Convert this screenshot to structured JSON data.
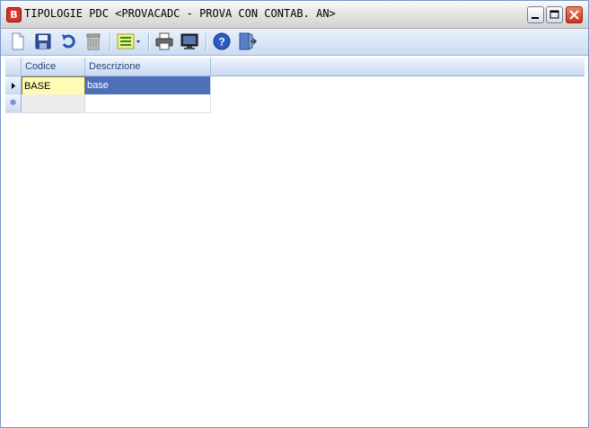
{
  "window": {
    "title": "TIPOLOGIE PDC <PROVACADC - PROVA CON CONTAB. AN>",
    "app_icon_letter": "B"
  },
  "toolbar": {
    "buttons": [
      {
        "name": "new-document-icon"
      },
      {
        "name": "save-icon"
      },
      {
        "name": "undo-icon"
      },
      {
        "name": "delete-trash-icon"
      },
      {
        "name": "list-options-icon"
      },
      {
        "name": "print-icon"
      },
      {
        "name": "preview-monitor-icon"
      },
      {
        "name": "help-icon"
      },
      {
        "name": "exit-icon"
      }
    ]
  },
  "grid": {
    "columns": [
      "Codice",
      "Descrizione"
    ],
    "rows": [
      {
        "codice": "BASE",
        "descrizione": "base",
        "selected": true
      }
    ],
    "new_row_marker": "✻"
  },
  "colors": {
    "selected_row": "#4f6fb8",
    "active_cell": "#fffbb4",
    "header_text": "#27467a",
    "close_button": "#c8361a"
  }
}
